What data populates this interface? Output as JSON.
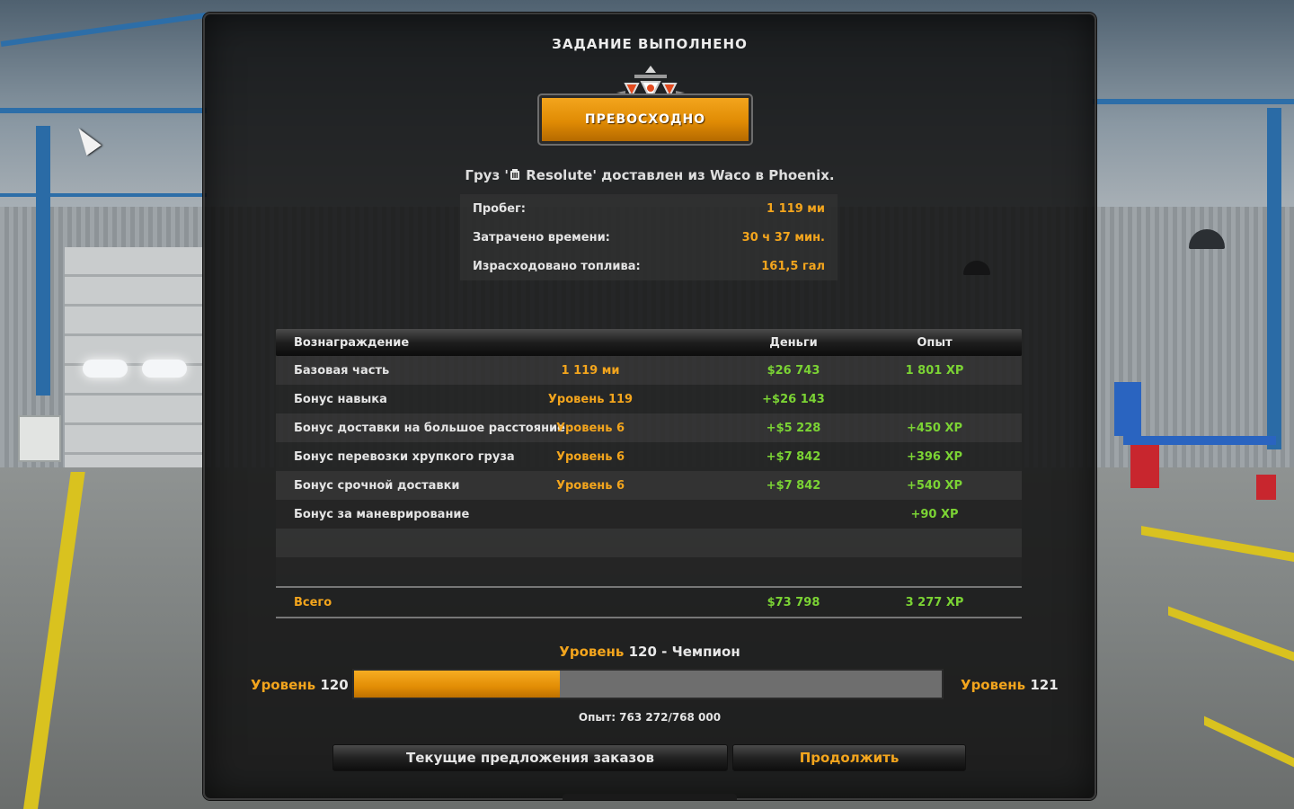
{
  "panel": {
    "title": "ЗАДАНИЕ ВЫПОЛНЕНО",
    "rating": "ПРЕВОСХОДНО",
    "cargo_text": "Груз '",
    "cargo_name": " Resolute' доставлен из Waco в Phoenix."
  },
  "stats": [
    {
      "label": "Пробег:",
      "value": "1 119 ми"
    },
    {
      "label": "Затрачено времени:",
      "value": "30 ч 37 мин."
    },
    {
      "label": "Израсходовано топлива:",
      "value": "161,5 гал"
    }
  ],
  "rewards": {
    "headers": {
      "name": "Вознаграждение",
      "money": "Деньги",
      "xp": "Опыт"
    },
    "rows": [
      {
        "name": "Базовая часть",
        "param": "1 119 ми",
        "money": "$26 743",
        "xp": "1 801 XP"
      },
      {
        "name": "Бонус навыка",
        "param": "Уровень 119",
        "money": "+$26 143",
        "xp": ""
      },
      {
        "name": "Бонус доставки на большое расстояние",
        "param": "Уровень 6",
        "money": "+$5 228",
        "xp": "+450 XP"
      },
      {
        "name": "Бонус перевозки хрупкого груза",
        "param": "Уровень 6",
        "money": "+$7 842",
        "xp": "+396 XP"
      },
      {
        "name": "Бонус срочной доставки",
        "param": "Уровень 6",
        "money": "+$7 842",
        "xp": "+540 XP"
      },
      {
        "name": "Бонус за маневрирование",
        "param": "",
        "money": "",
        "xp": "+90 XP"
      },
      {
        "name": "",
        "param": "",
        "money": "",
        "xp": ""
      },
      {
        "name": "",
        "param": "",
        "money": "",
        "xp": ""
      }
    ],
    "total": {
      "name": "Всего",
      "money": "$73 798",
      "xp": "3 277 XP"
    }
  },
  "level": {
    "word": "Уровень",
    "current": "120",
    "title_suffix": " - Чемпион",
    "next": "121",
    "progress": 0.35,
    "xp_text": "Опыт: 763 272/768 000"
  },
  "buttons": {
    "offers": "Текущие предложения заказов",
    "continue": "Продолжить"
  },
  "colors": {
    "accent_orange": "#f3a51d",
    "positive_green": "#7bd334",
    "panel_bg": "#121212"
  },
  "icons": [
    "cargo-icon",
    "emblem-icon",
    "mouse-cursor-icon"
  ]
}
